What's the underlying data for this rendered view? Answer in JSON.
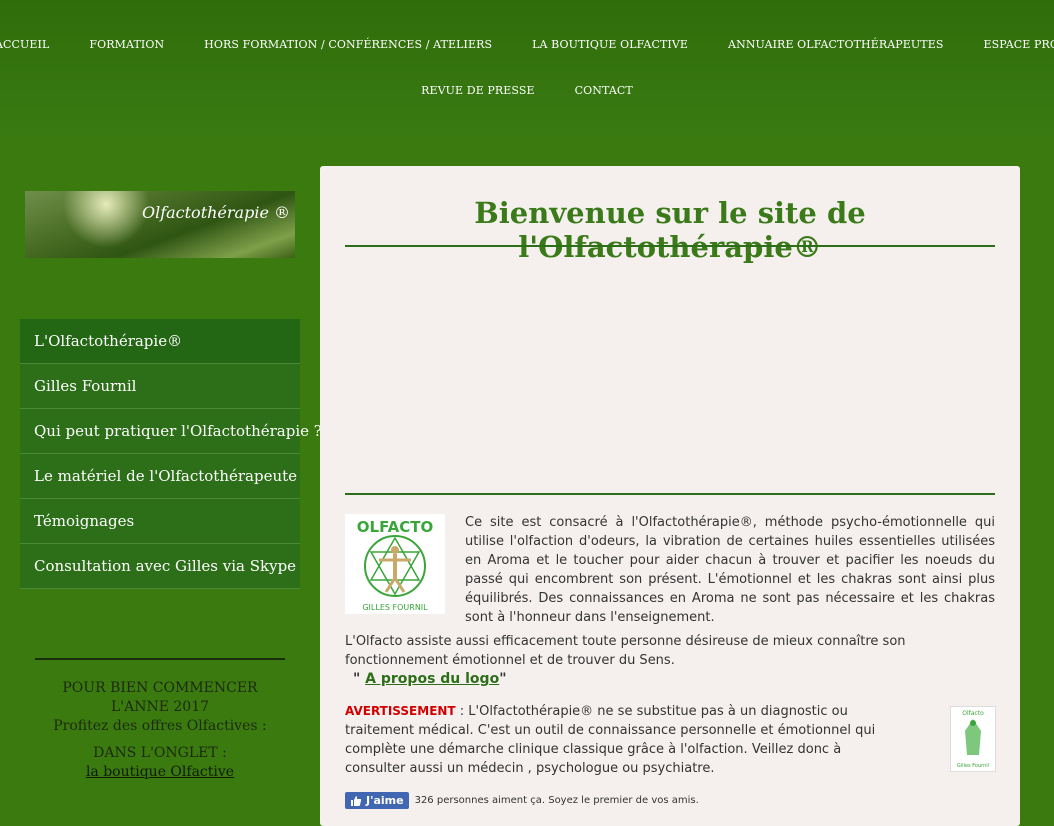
{
  "topnav": {
    "row1": [
      "ACCUEIL",
      "FORMATION",
      "HORS FORMATION / CONFÉRENCES / ATELIERS",
      "LA BOUTIQUE OLFACTIVE",
      "ANNUAIRE OLFACTOTHÉRAPEUTES",
      "ESPACE PRO"
    ],
    "row2": [
      "REVUE DE PRESSE",
      "CONTACT"
    ]
  },
  "brand": {
    "title": "Olfactothérapie ®"
  },
  "sidemenu": [
    "L'Olfactothérapie®",
    "Gilles Fournil",
    "Qui peut pratiquer l'Olfactothérapie ?",
    "Le matériel de l'Olfactothérapeute",
    "Témoignages",
    "Consultation avec Gilles via Skype"
  ],
  "side": {
    "promo_line1": "POUR BIEN COMMENCER",
    "promo_line2": "L'ANNE 2017",
    "promo_line3": "Profitez  des offres Olfactives :",
    "tab_text": "DANS L'ONGLET :",
    "tab_link": "la boutique Olfactive"
  },
  "main": {
    "title": "Bienvenue sur le site de l'Olfactothérapie®",
    "intro": "Ce site est consacré à l'Olfactothérapie®, méthode psycho-émotionnelle qui utilise l'olfaction d'odeurs, la vibration de certaines huiles essentielles utilisées en Aroma et le toucher pour aider chacun à trouver et pacifier les noeuds du passé qui encombrent son présent. L'émotionnel et les chakras sont ainsi plus équilibrés. Des connaissances en Aroma ne sont pas nécessaire et les chakras sont à l'honneur dans l'enseignement.",
    "intro2": "L'Olfacto assiste aussi efficacement toute personne désireuse de mieux connaître son fonctionnement émotionnel et de trouver du Sens.",
    "apropos_quote_open": "\" ",
    "apropos_link": "A propos du logo",
    "apropos_quote_close": "\"",
    "warning_label": "AVERTISSEMENT",
    "warning_text": " : L'Olfactothérapie® ne se substitue pas à un diagnostic ou traitement médical. C'est un outil de connaissance personnelle et émotionnel qui complète une démarche clinique classique grâce à l'olfaction. Veillez donc à consulter aussi un médecin , psychologue ou psychiatre.",
    "logo_text_top": "OLFACTO",
    "logo_text_bottom": "GILLES FOURNIL",
    "small_logo_top": "Olfacto",
    "small_logo_bottom": "Gilles Fournil",
    "fb_button": "J'aime",
    "fb_text": "326 personnes aiment ça. Soyez le premier de vos amis."
  },
  "colors": {
    "nav_bg": "#2f6d0a",
    "page_bg": "#3b7a0e",
    "menu_bg": "#2c6f18",
    "title_green": "#3a7a19",
    "warning_red": "#d10000",
    "panel_bg": "#f5f0ee",
    "fb_blue": "#4267b2"
  }
}
